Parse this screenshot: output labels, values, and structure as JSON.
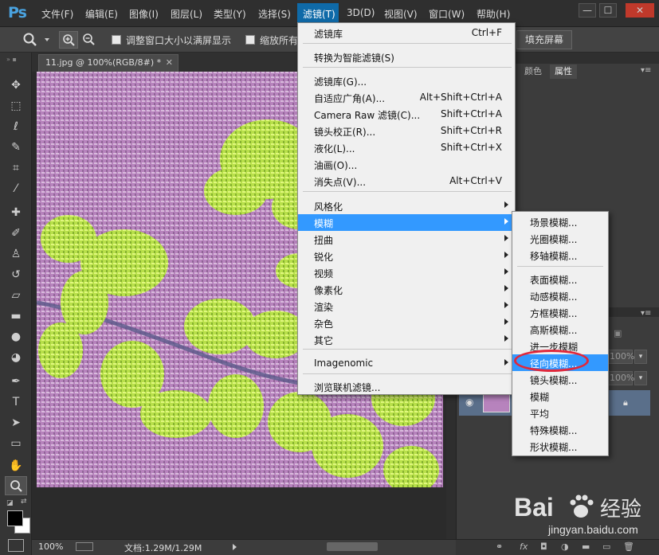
{
  "app": {
    "logo": "Ps"
  },
  "menubar": {
    "items": [
      "文件(F)",
      "编辑(E)",
      "图像(I)",
      "图层(L)",
      "类型(Y)",
      "选择(S)",
      "滤镜(T)",
      "3D(D)",
      "视图(V)",
      "窗口(W)",
      "帮助(H)"
    ],
    "active": "滤镜(T)"
  },
  "window_controls": {
    "minimize": "—",
    "restore": "☐",
    "close": "✕"
  },
  "options_bar": {
    "resize_windows_label": "调整窗口大小以满屏显示",
    "zoom_all_label": "缩放所有",
    "fill_screen_button": "填充屏幕"
  },
  "document": {
    "tab_title": "11.jpg @ 100%(RGB/8#) *",
    "zoom": "100%",
    "doc_info": "文档:1.29M/1.29M"
  },
  "panels": {
    "tabs": [
      "颜色",
      "属性"
    ],
    "layer_opacity": "100%",
    "layer_fill": "100%"
  },
  "filter_menu": {
    "items": [
      {
        "label": "滤镜库",
        "shortcut": "Ctrl+F"
      },
      {
        "separator": true
      },
      {
        "label": "转换为智能滤镜(S)"
      },
      {
        "separator": true
      },
      {
        "label": "滤镜库(G)..."
      },
      {
        "label": "自适应广角(A)...",
        "shortcut": "Alt+Shift+Ctrl+A"
      },
      {
        "label": "Camera Raw 滤镜(C)...",
        "shortcut": "Shift+Ctrl+A"
      },
      {
        "label": "镜头校正(R)...",
        "shortcut": "Shift+Ctrl+R"
      },
      {
        "label": "液化(L)...",
        "shortcut": "Shift+Ctrl+X"
      },
      {
        "label": "油画(O)..."
      },
      {
        "label": "消失点(V)...",
        "shortcut": "Alt+Ctrl+V"
      },
      {
        "separator": true
      },
      {
        "label": "风格化",
        "submenu": true
      },
      {
        "label": "模糊",
        "submenu": true,
        "highlighted": true
      },
      {
        "label": "扭曲",
        "submenu": true
      },
      {
        "label": "锐化",
        "submenu": true
      },
      {
        "label": "视频",
        "submenu": true
      },
      {
        "label": "像素化",
        "submenu": true
      },
      {
        "label": "渲染",
        "submenu": true
      },
      {
        "label": "杂色",
        "submenu": true
      },
      {
        "label": "其它",
        "submenu": true
      },
      {
        "separator": true
      },
      {
        "label": "Imagenomic",
        "submenu": true
      },
      {
        "separator": true
      },
      {
        "label": "浏览联机滤镜..."
      }
    ]
  },
  "blur_submenu": {
    "items": [
      {
        "label": "场景模糊..."
      },
      {
        "label": "光圈模糊..."
      },
      {
        "label": "移轴模糊..."
      },
      {
        "separator": true
      },
      {
        "label": "表面模糊..."
      },
      {
        "label": "动感模糊..."
      },
      {
        "label": "方框模糊..."
      },
      {
        "label": "高斯模糊..."
      },
      {
        "label": "进一步模糊"
      },
      {
        "label": "径向模糊...",
        "highlighted": true
      },
      {
        "label": "镜头模糊..."
      },
      {
        "label": "模糊"
      },
      {
        "label": "平均"
      },
      {
        "label": "特殊模糊..."
      },
      {
        "label": "形状模糊..."
      }
    ]
  },
  "watermark": {
    "brand": "Bai 经验",
    "url": "jingyan.baidu.com"
  },
  "colors": {
    "highlight": "#3399ff",
    "annotation": "#e0283c",
    "ps_blue": "#4aa3e0"
  }
}
